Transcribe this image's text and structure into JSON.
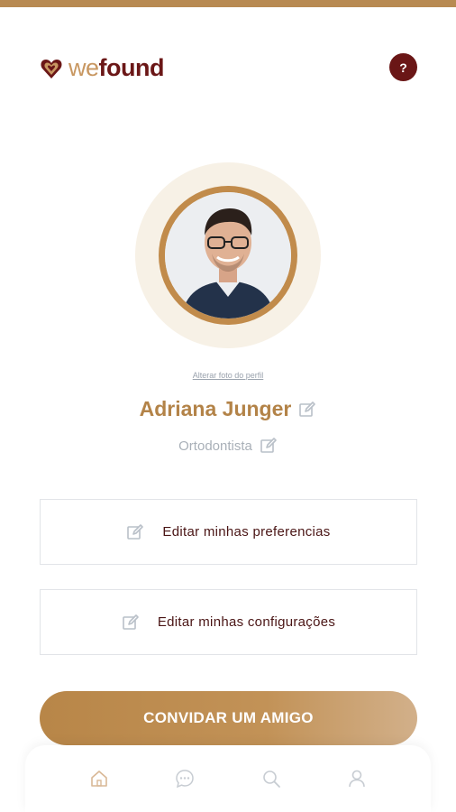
{
  "header": {
    "logo_we": "we",
    "logo_found": "found",
    "help_label": "?"
  },
  "profile": {
    "change_photo_label": "Alterar foto do perfil",
    "name": "Adriana Junger",
    "role": "Ortodontista"
  },
  "options": [
    {
      "label": "Editar minhas preferencias",
      "icon": "edit-icon"
    },
    {
      "label": "Editar minhas configurações",
      "icon": "edit-icon"
    }
  ],
  "invite_button": {
    "label": "CONVIDAR UM AMIGO"
  },
  "bottom_nav": [
    {
      "icon": "home-icon"
    },
    {
      "icon": "chat-icon"
    },
    {
      "icon": "search-icon"
    },
    {
      "icon": "user-icon"
    }
  ],
  "colors": {
    "accent": "#b88648",
    "brand_dark": "#6a1616",
    "avatar_halo": "#f7f1e6",
    "muted_text": "#a9b0b8"
  }
}
